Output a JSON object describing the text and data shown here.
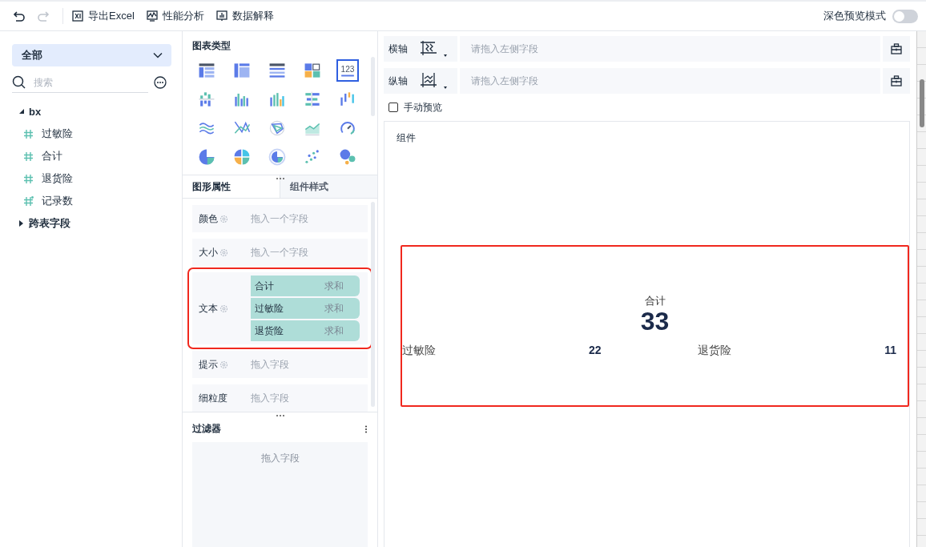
{
  "toolbar": {
    "undo_disabled": false,
    "redo_disabled": true,
    "actions": [
      {
        "label": "导出Excel",
        "kind": "excel"
      },
      {
        "label": "性能分析",
        "kind": "perf"
      },
      {
        "label": "数据解释",
        "kind": "explain"
      }
    ],
    "dark_preview": {
      "label": "深色预览模式",
      "on": false
    }
  },
  "field_panel": {
    "dataset_select": "全部",
    "search": {
      "placeholder": "搜索"
    },
    "tree": [
      {
        "label": "bx",
        "expanded": true,
        "children": [
          {
            "label": "过敏险",
            "kind": "measure"
          },
          {
            "label": "合计",
            "kind": "measure"
          },
          {
            "label": "退货险",
            "kind": "measure"
          },
          {
            "label": "记录数",
            "kind": "count"
          }
        ]
      },
      {
        "label": "跨表字段",
        "expanded": false
      }
    ]
  },
  "chart_types": {
    "title": "图表类型",
    "items": [
      {
        "kind": "table",
        "selected": false
      },
      {
        "kind": "crosstable",
        "selected": false
      },
      {
        "kind": "grid",
        "selected": false
      },
      {
        "kind": "blocks",
        "selected": false
      },
      {
        "kind": "kpi",
        "selected": true,
        "label": "123"
      },
      {
        "kind": "dotbar",
        "selected": false
      },
      {
        "kind": "column",
        "selected": false
      },
      {
        "kind": "column2",
        "selected": false
      },
      {
        "kind": "hbar",
        "selected": false
      },
      {
        "kind": "range",
        "selected": false
      },
      {
        "kind": "wave",
        "selected": false
      },
      {
        "kind": "cross",
        "selected": false
      },
      {
        "kind": "radar",
        "selected": false
      },
      {
        "kind": "area",
        "selected": false
      },
      {
        "kind": "gauge",
        "selected": false
      },
      {
        "kind": "pie",
        "selected": false
      },
      {
        "kind": "pie2",
        "selected": false
      },
      {
        "kind": "ring",
        "selected": false
      },
      {
        "kind": "scatter",
        "selected": false
      },
      {
        "kind": "bubble",
        "selected": false
      }
    ]
  },
  "property_tabs": [
    {
      "label": "图形属性",
      "selected": true
    },
    {
      "label": "组件样式",
      "selected": false
    }
  ],
  "properties": [
    {
      "label": "颜色",
      "has_settings": true,
      "placeholder": "拖入一个字段",
      "highlighted": false
    },
    {
      "label": "大小",
      "has_settings": true,
      "placeholder": "拖入一个字段",
      "highlighted": false
    },
    {
      "label": "文本",
      "has_settings": true,
      "highlighted": true,
      "fields": [
        {
          "name": "合计",
          "aggregation": "求和"
        },
        {
          "name": "过敏险",
          "aggregation": "求和"
        },
        {
          "name": "退货险",
          "aggregation": "求和"
        }
      ]
    },
    {
      "label": "提示",
      "has_settings": true,
      "placeholder": "拖入字段",
      "highlighted": false
    },
    {
      "label": "细粒度",
      "has_settings": false,
      "placeholder": "拖入字段",
      "highlighted": false
    }
  ],
  "filter": {
    "title": "过滤器",
    "placeholder": "拖入字段"
  },
  "axes": [
    {
      "label": "横轴",
      "kind": "x",
      "placeholder": "请拖入左侧字段"
    },
    {
      "label": "纵轴",
      "kind": "y",
      "placeholder": "请拖入左侧字段"
    }
  ],
  "manual_preview": {
    "label": "手动预览",
    "checked": false
  },
  "preview": {
    "title": "组件",
    "kpi": {
      "highlighted": true,
      "label": "合计",
      "value": "33",
      "items": [
        {
          "label": "过敏险",
          "value": "22"
        },
        {
          "label": "退货险",
          "value": "11"
        }
      ]
    }
  }
}
